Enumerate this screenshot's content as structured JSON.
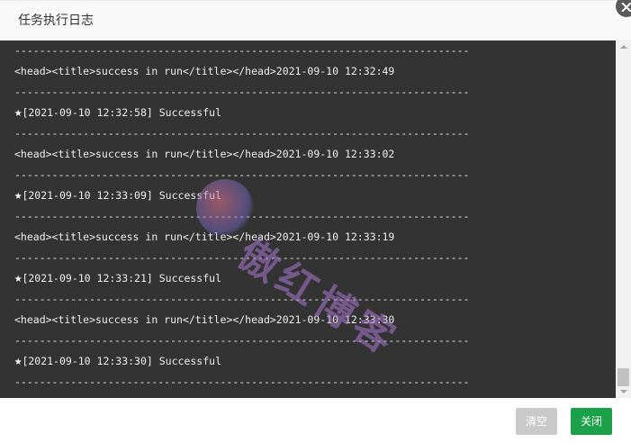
{
  "dialog": {
    "title": "任务执行日志"
  },
  "watermark": {
    "text": "傲红博客"
  },
  "log": {
    "lines": [
      {
        "type": "sep",
        "text": "-------------------------------------------------------------------------"
      },
      {
        "type": "text",
        "text": "<head><title>success in run</title></head>2021-09-10 12:32:49"
      },
      {
        "type": "sep",
        "text": "-------------------------------------------------------------------------"
      },
      {
        "type": "star",
        "text": "[2021-09-10 12:32:58] Successful"
      },
      {
        "type": "sep",
        "text": "-------------------------------------------------------------------------"
      },
      {
        "type": "text",
        "text": "<head><title>success in run</title></head>2021-09-10 12:33:02"
      },
      {
        "type": "sep",
        "text": "-------------------------------------------------------------------------"
      },
      {
        "type": "star",
        "text": "[2021-09-10 12:33:09] Successful"
      },
      {
        "type": "sep",
        "text": "-------------------------------------------------------------------------"
      },
      {
        "type": "text",
        "text": "<head><title>success in run</title></head>2021-09-10 12:33:19"
      },
      {
        "type": "sep",
        "text": "-------------------------------------------------------------------------"
      },
      {
        "type": "star",
        "text": "[2021-09-10 12:33:21] Successful"
      },
      {
        "type": "sep",
        "text": "-------------------------------------------------------------------------"
      },
      {
        "type": "text",
        "text": "<head><title>success in run</title></head>2021-09-10 12:33:30"
      },
      {
        "type": "sep",
        "text": "-------------------------------------------------------------------------"
      },
      {
        "type": "star",
        "text": "[2021-09-10 12:33:30] Successful"
      },
      {
        "type": "sep",
        "text": "-------------------------------------------------------------------------"
      }
    ],
    "star_glyph": "★"
  },
  "footer": {
    "clear_label": "清空",
    "close_label": "关闭"
  },
  "colors": {
    "log_background": "#333333",
    "close_button": "#1aa14a",
    "clear_button": "#c9c9c9"
  }
}
